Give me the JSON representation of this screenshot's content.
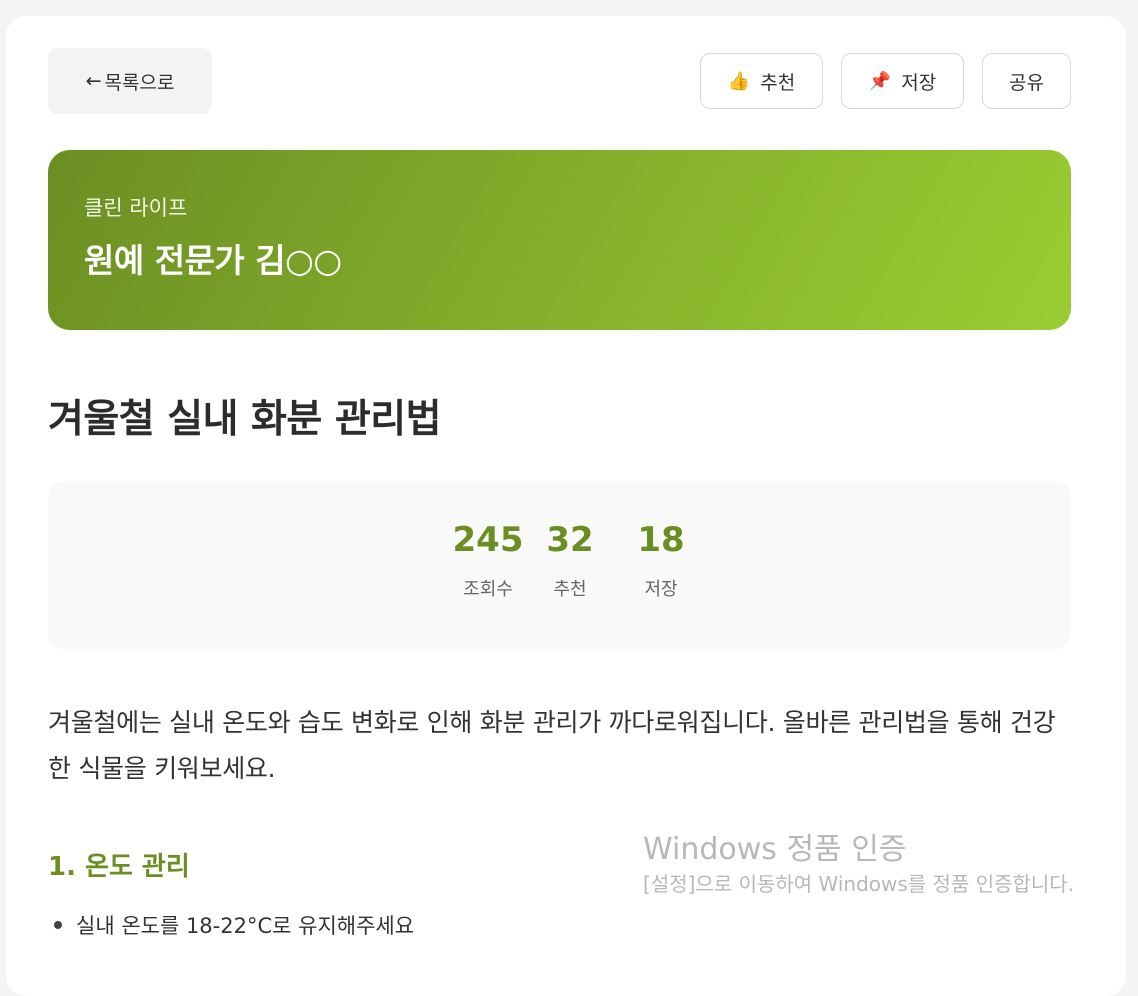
{
  "header": {
    "back_label": "목록으로",
    "back_arrow": "←",
    "actions": [
      {
        "icon": "thumbs-up-icon",
        "glyph": "👍",
        "label": "추천"
      },
      {
        "icon": "pushpin-icon",
        "glyph": "📌",
        "label": "저장"
      },
      {
        "label": "공유"
      }
    ]
  },
  "banner": {
    "category": "클린 라이프",
    "author": "원예 전문가 김○○",
    "gradient": [
      "#6b8e23",
      "#9acd32"
    ]
  },
  "article": {
    "title": "겨울철 실내 화분 관리법",
    "intro": "겨울철에는 실내 온도와 습도 변화로 인해 화분 관리가 까다로워집니다. 올바른 관리법을 통해 건강한 식물을 키워보세요.",
    "section1_heading": "1. 온도 관리",
    "section1_items": [
      "실내 온도를 18-22°C로 유지해주세요"
    ]
  },
  "stats": [
    {
      "value": "245",
      "label": "조회수"
    },
    {
      "value": "32",
      "label": "추천"
    },
    {
      "value": "18",
      "label": "저장"
    }
  ],
  "accent_color": "#6b8e23",
  "watermark": {
    "line1": "Windows 정품 인증",
    "line2": "[설정]으로 이동하여 Windows를 정품 인증합니다."
  }
}
